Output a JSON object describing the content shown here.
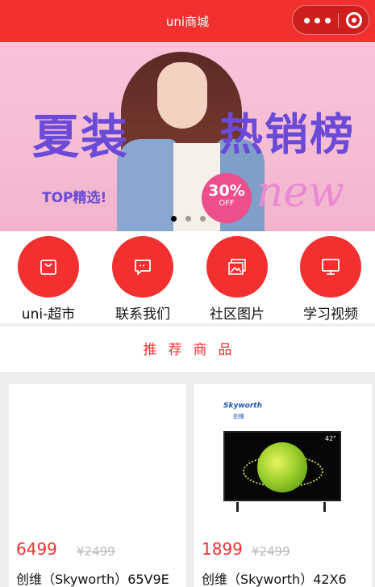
{
  "navbar": {
    "title": "uni商城",
    "menu_icon": "more-dots-icon",
    "close_icon": "target-circle-icon"
  },
  "banner": {
    "headline_left": "夏装",
    "headline_right": "热销榜",
    "subline": "TOP精选!",
    "discount": "30%",
    "discount_suffix": "OFF",
    "script_word": "new",
    "slide_count": 3,
    "active_slide": 1
  },
  "categories": [
    {
      "label": "uni-超市",
      "icon": "shopping-bag-icon"
    },
    {
      "label": "联系我们",
      "icon": "message-icon"
    },
    {
      "label": "社区图片",
      "icon": "image-icon"
    },
    {
      "label": "学习视频",
      "icon": "monitor-icon"
    }
  ],
  "recommend": {
    "title": "推荐商品"
  },
  "products": [
    {
      "price": "6499",
      "original_price": "¥2499",
      "name": "创维（Skyworth）65V9E"
    },
    {
      "price": "1899",
      "original_price": "¥2499",
      "name": "创维（Skyworth）42X6",
      "brand_en": "Skyworth",
      "brand_cn": "创维",
      "screen_size": "42\""
    }
  ],
  "colors": {
    "accent": "#f23030",
    "banner_purple": "#6a4ad6",
    "background_gray": "#eeeeee"
  }
}
